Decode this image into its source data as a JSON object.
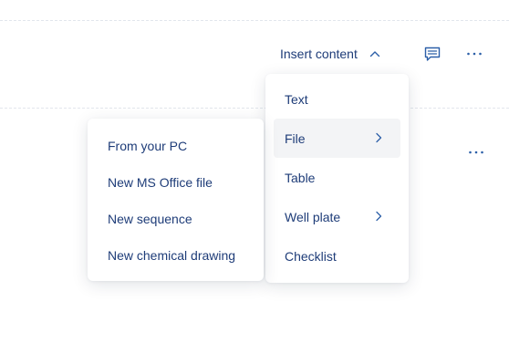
{
  "toolbar": {
    "insert_content_label": "Insert content",
    "comment_icon": "comment-icon",
    "more_icon": "more-horizontal-icon",
    "chevron_icon": "chevron-up-icon"
  },
  "insert_menu": {
    "items": [
      {
        "label": "Text",
        "has_submenu": false
      },
      {
        "label": "File",
        "has_submenu": true,
        "active": true
      },
      {
        "label": "Table",
        "has_submenu": false
      },
      {
        "label": "Well plate",
        "has_submenu": true
      },
      {
        "label": "Checklist",
        "has_submenu": false
      }
    ]
  },
  "file_submenu": {
    "items": [
      {
        "label": "From your PC"
      },
      {
        "label": "New MS Office file"
      },
      {
        "label": "New sequence"
      },
      {
        "label": "New chemical drawing"
      }
    ]
  },
  "colors": {
    "text": "#1e3c78",
    "icon": "#2c5fa8",
    "active_bg": "#f3f4f6",
    "divider": "#e2e6ec"
  }
}
